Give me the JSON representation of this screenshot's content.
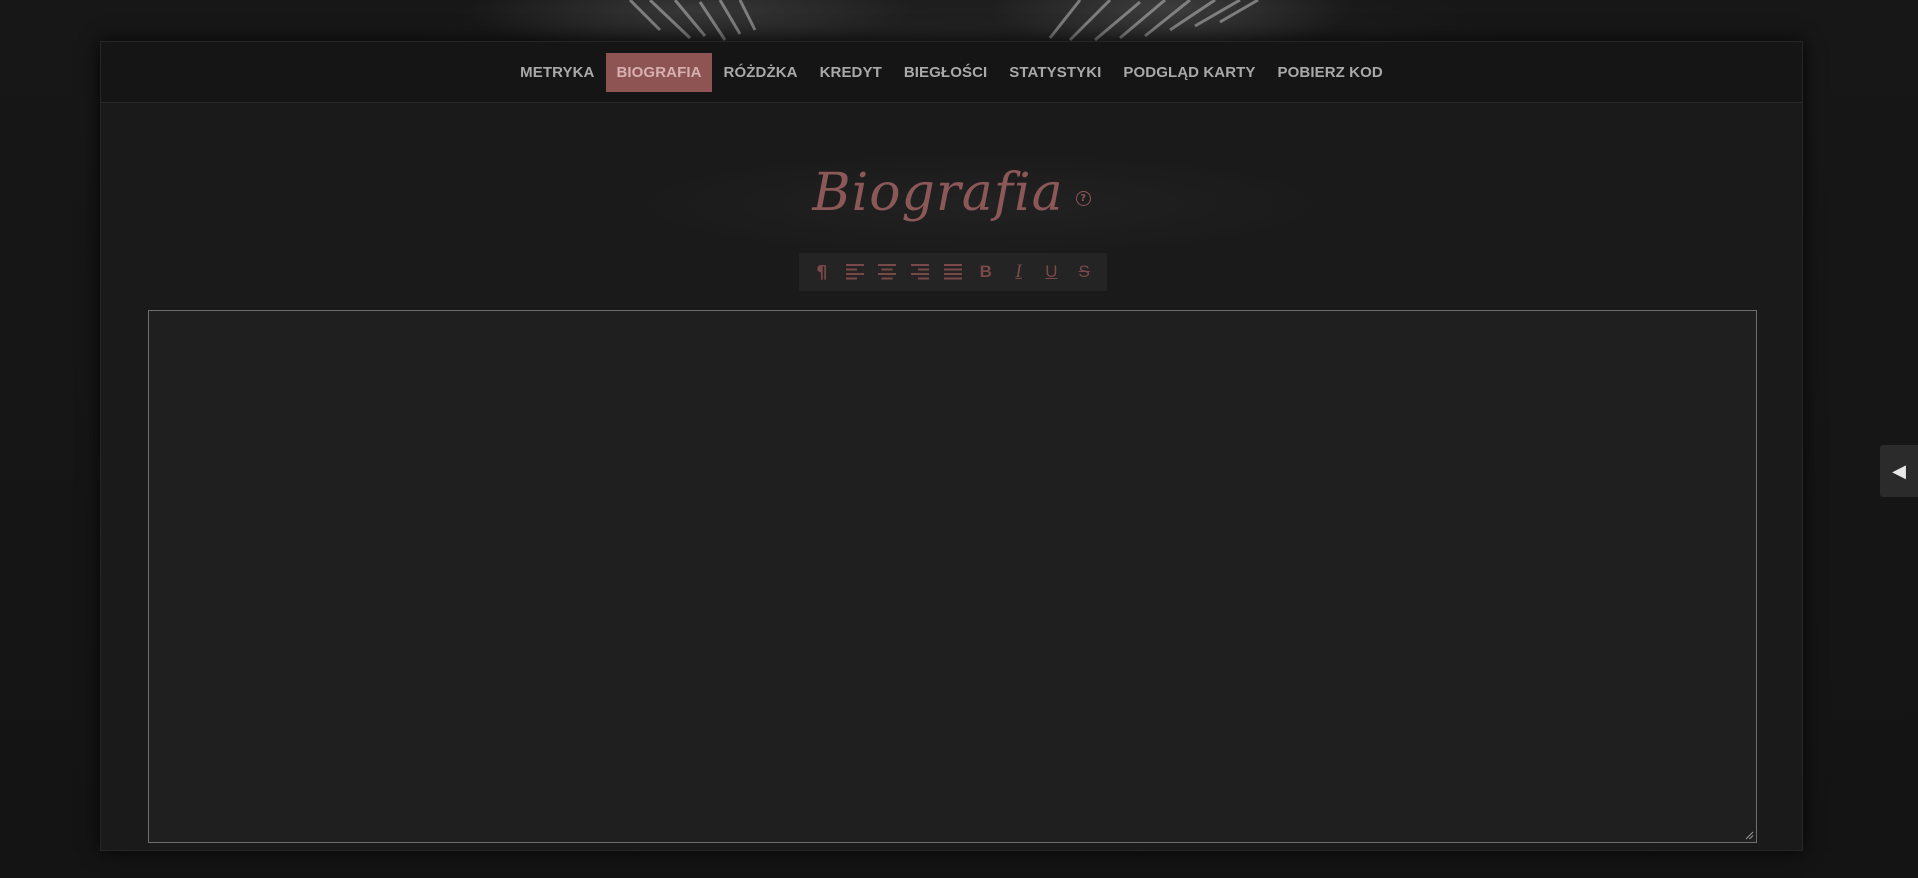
{
  "nav": {
    "tabs": [
      {
        "label": "METRYKA",
        "active": false
      },
      {
        "label": "BIOGRAFIA",
        "active": true
      },
      {
        "label": "RÓŻDŻKA",
        "active": false
      },
      {
        "label": "KREDYT",
        "active": false
      },
      {
        "label": "BIEGŁOŚCI",
        "active": false
      },
      {
        "label": "STATYSTYKI",
        "active": false
      },
      {
        "label": "PODGLĄD KARTY",
        "active": false
      },
      {
        "label": "POBIERZ KOD",
        "active": false
      }
    ]
  },
  "section": {
    "title": "Biografia",
    "help_glyph": "?"
  },
  "toolbar": {
    "buttons": [
      {
        "name": "paragraph-icon",
        "glyph": "¶"
      },
      {
        "name": "align-left-icon"
      },
      {
        "name": "align-center-icon"
      },
      {
        "name": "align-right-icon"
      },
      {
        "name": "align-justify-icon"
      },
      {
        "name": "bold-icon",
        "glyph": "B"
      },
      {
        "name": "italic-icon",
        "glyph": "I"
      },
      {
        "name": "underline-icon",
        "glyph": "U"
      },
      {
        "name": "strikethrough-icon",
        "glyph": "S"
      }
    ]
  },
  "editor": {
    "value": "",
    "placeholder": ""
  },
  "side_toggle": {
    "glyph": "◀"
  },
  "colors": {
    "accent": "#8e5454",
    "accent_text": "#8c5757",
    "nav_text": "#a9a9a9",
    "panel_bg": "#1a1a1a",
    "editor_bg": "#1f1f1f"
  }
}
